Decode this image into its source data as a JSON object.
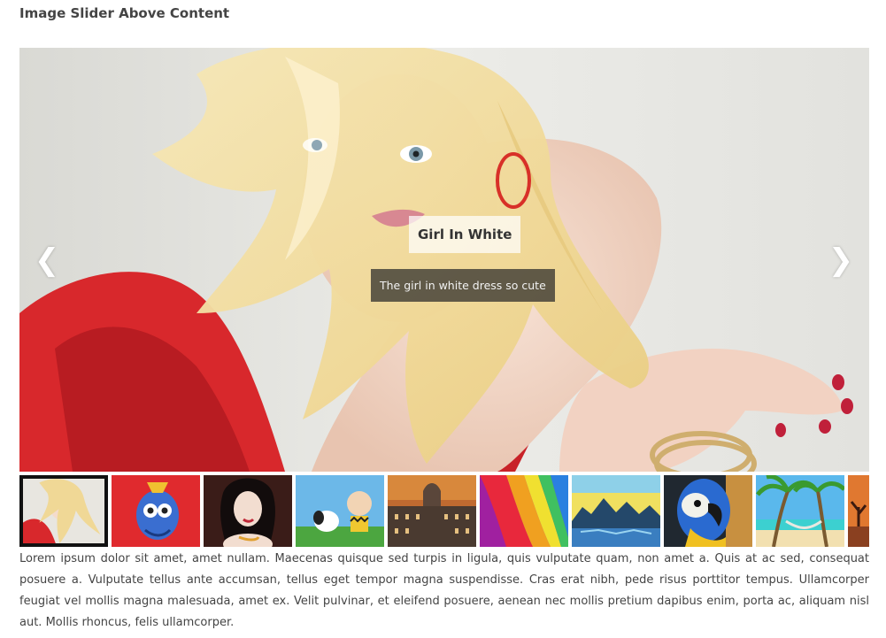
{
  "page": {
    "title": "Image Slider Above Content"
  },
  "slider": {
    "current_slide": {
      "title": "Girl In White",
      "description": "The girl in white dress so cute",
      "image": "blonde-woman-red-dress-photo"
    },
    "prev_arrow": "❮",
    "next_arrow": "❯",
    "thumbnails": [
      {
        "image": "blonde-woman-thumb",
        "active": true
      },
      {
        "image": "blue-cartoon-character-upside-down"
      },
      {
        "image": "dark-haired-woman-portrait"
      },
      {
        "image": "snoopy-and-charlie-brown"
      },
      {
        "image": "city-building-at-sunset"
      },
      {
        "image": "colorful-rainbow-waves"
      },
      {
        "image": "icy-mountains-sunset-lake"
      },
      {
        "image": "macaw-parrot-closeup"
      },
      {
        "image": "tropical-beach-palm-hammock"
      },
      {
        "image": "desert-tree-sunset"
      }
    ]
  },
  "content": {
    "text": "Lorem ipsum dolor sit amet, amet nullam. Maecenas quisque sed turpis in ligula, quis vulputate quam, non amet a. Quis at ac sed, consequat posuere a. Vulputate tellus ante accumsan, tellus eget tempor magna suspendisse. Cras erat nibh, pede risus porttitor tempus. Ullamcorper feugiat vel mollis magna malesuada, amet ex. Velit pulvinar, et eleifend posuere, aenean nec mollis pretium dapibus enim, porta ac, aliquam nisl aut. Mollis rhoncus, felis ullamcorper."
  },
  "colors": {
    "active_thumb_border": "#111111",
    "dress_red": "#d8282c",
    "hair_blonde": "#f0dc9a"
  }
}
